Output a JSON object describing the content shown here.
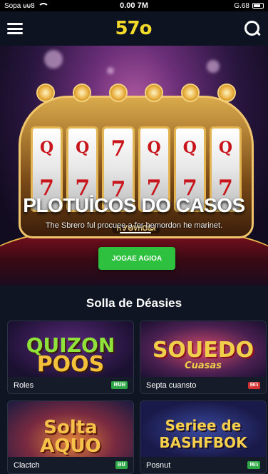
{
  "status_bar": {
    "carrier": "Sopa ᵾᵾ8",
    "time": "0.00 7M",
    "battery_text": "G.68"
  },
  "header": {
    "logo": "57o"
  },
  "hero": {
    "reel_symbols": [
      [
        "Q",
        "7"
      ],
      [
        "Q",
        "7"
      ],
      [
        "7",
        "7"
      ],
      [
        "Q",
        "7"
      ],
      [
        "Q",
        "7"
      ],
      [
        "Q",
        "7"
      ]
    ],
    "machine_label": "Ꮒ ᎩᎾᏙᏂᏣᏋᏗ",
    "title": "PLOTUİCOS DO CASOS",
    "subtitle": "The Sbrero ful procuee ǝ for hemordon he marinet.",
    "cta_label": "JOGAE AGIOA"
  },
  "section": {
    "title": "Solla de Déasies"
  },
  "games": [
    {
      "art_line1": "QUIZON",
      "art_line2": "POOS",
      "name": "Roles",
      "badge": "ᕼᑌᗷ",
      "badge_color": "#2ea845"
    },
    {
      "art_line1": "SOUEDO",
      "art_line2": "Cuasas",
      "name": "Septa cuansto",
      "badge": "ᗷᗩ",
      "badge_color": "#d23232"
    },
    {
      "art_line1": "Solta",
      "art_line2": "AQUO",
      "name": "Clactch",
      "badge": "ᗷᑌ",
      "badge_color": "#2ea845"
    },
    {
      "art_line1": "Seriee de",
      "art_line2": "BASHFBOK",
      "name": "Posnut",
      "badge": "ᕼᗩ",
      "badge_color": "#2ea845"
    }
  ]
}
